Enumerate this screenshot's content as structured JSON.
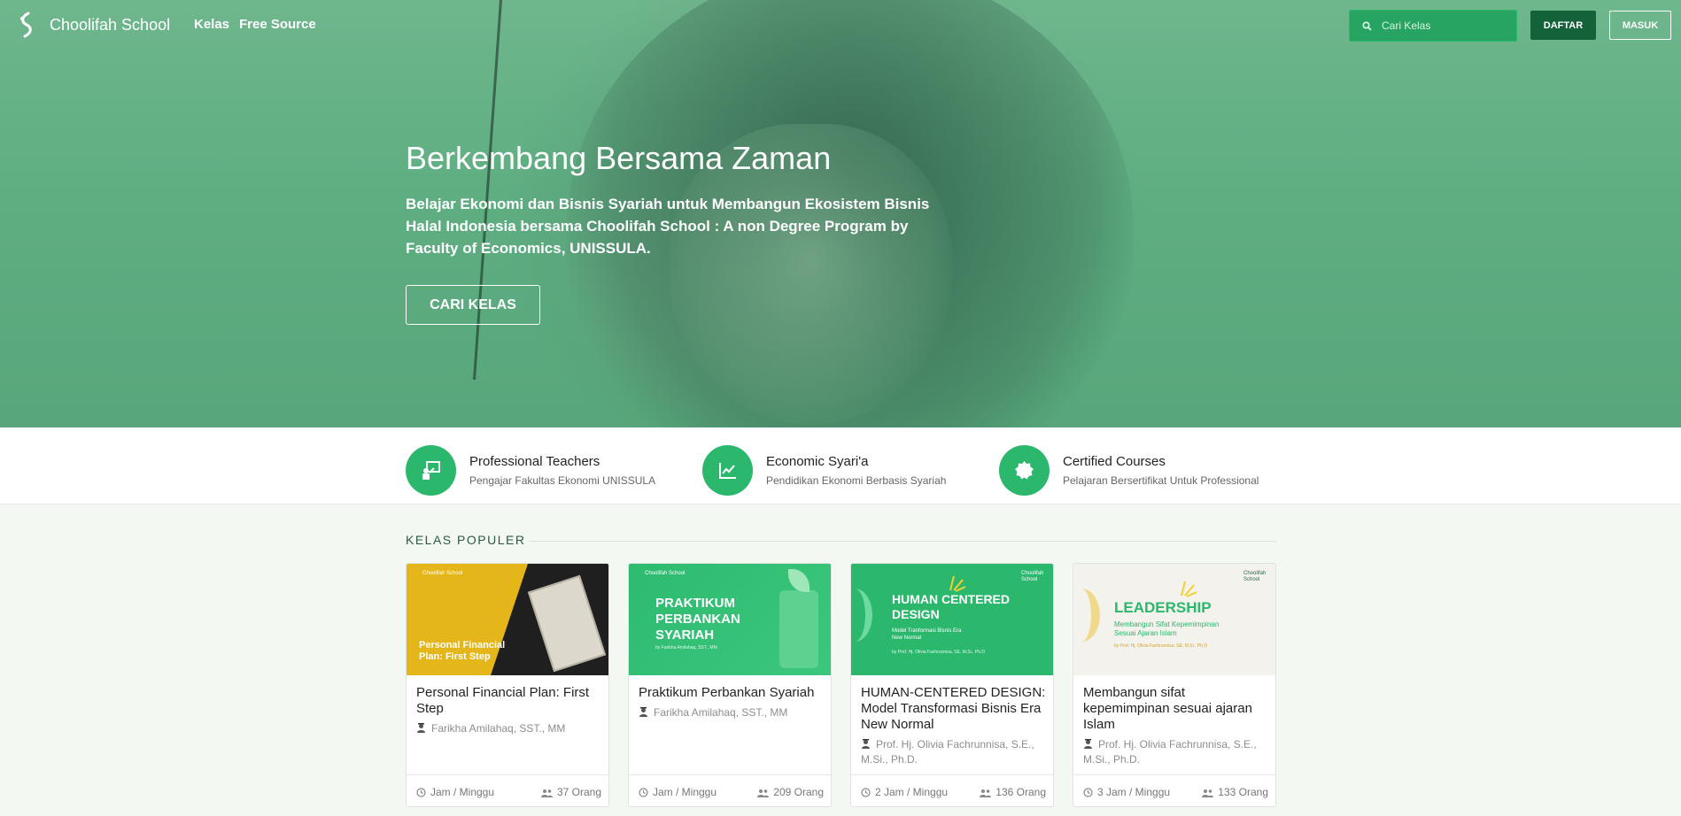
{
  "nav": {
    "brand": "Choolifah School",
    "links": [
      {
        "label": "Kelas"
      },
      {
        "label": "Free Source"
      }
    ],
    "search_placeholder": "Cari Kelas",
    "daftar_label": "DAFTAR",
    "masuk_label": "MASUK"
  },
  "hero": {
    "title": "Berkembang Bersama Zaman",
    "subtitle": "Belajar Ekonomi dan Bisnis Syariah untuk Membangun Ekosistem Bisnis Halal Indonesia bersama Choolifah School : A non Degree Program by Faculty of Economics, UNISSULA.",
    "cta_label": "CARI KELAS"
  },
  "features": [
    {
      "title": "Professional Teachers",
      "desc": "Pengajar Fakultas Ekonomi UNISSULA",
      "icon": "teacher-board-icon"
    },
    {
      "title": "Economic Syari'a",
      "desc": "Pendidikan Ekonomi Berbasis Syariah",
      "icon": "chart-trend-icon"
    },
    {
      "title": "Certified Courses",
      "desc": "Pelajaran Bersertifikat Untuk Professional",
      "icon": "certificate-badge-icon"
    }
  ],
  "section": {
    "title": "KELAS POPULER"
  },
  "courses": [
    {
      "title": "Personal Financial Plan: First Step",
      "author": "Farikha Amilahaq, SST., MM",
      "duration": "Jam / Minggu",
      "students": "37 Orang",
      "thumb": {
        "brand": "Choolifah School",
        "text": "Personal Financial Plan: First Step"
      }
    },
    {
      "title": "Praktikum Perbankan Syariah",
      "author": "Farikha Amilahaq, SST., MM",
      "duration": "Jam / Minggu",
      "students": "209 Orang",
      "thumb": {
        "brand": "Choolifah School",
        "text": "PRAKTIKUM PERBANKAN SYARIAH",
        "sub": "by Farikha Amilahaq, SST., MM"
      }
    },
    {
      "title": "HUMAN-CENTERED DESIGN: Model Transformasi Bisnis Era New Normal",
      "author": "Prof. Hj. Olivia Fachrunnisa, S.E., M.Si., Ph.D.",
      "duration": "2 Jam / Minggu",
      "students": "136 Orang",
      "thumb": {
        "brand": "Choolifah School",
        "text": "HUMAN CENTERED DESIGN",
        "sub": "Model Tranformasi Bisnis Era New Normal",
        "by": "by Prof. Hj. Olivia Fachrunnisa, SE, M.Si., Ph.D"
      }
    },
    {
      "title": "Membangun sifat kepemimpinan sesuai ajaran Islam",
      "author": "Prof. Hj. Olivia Fachrunnisa, S.E., M.Si., Ph.D.",
      "duration": "3 Jam / Minggu",
      "students": "133 Orang",
      "thumb": {
        "brand": "Choolifah School",
        "text": "LEADERSHIP",
        "sub": "Membangun Sifat Kepemimpinan Sesuai Ajaran Islam",
        "by": "by Prof. Hj. Olivia Fachrunnisa, SE, M.Si., Ph.D"
      }
    }
  ],
  "colors": {
    "brand_green": "#2bb86d",
    "dark_green": "#13623a",
    "hero_tint": "#5fae82"
  }
}
